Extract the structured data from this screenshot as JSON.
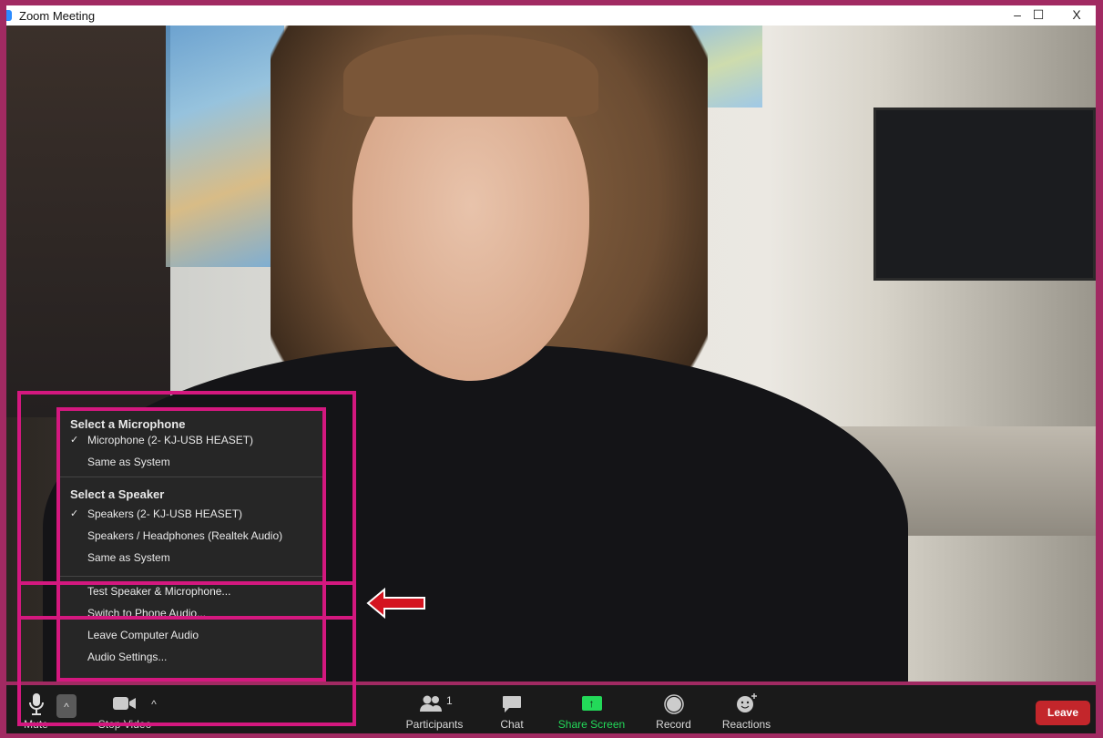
{
  "window": {
    "title": "Zoom Meeting",
    "minimize": "–",
    "maximize": "☐",
    "close": "X"
  },
  "audio_menu": {
    "mic_header": "Select a Microphone",
    "mics": [
      {
        "label": "Microphone (2- KJ-USB HEASET)",
        "checked": true
      },
      {
        "label": "Same as System",
        "checked": false
      }
    ],
    "speaker_header": "Select a Speaker",
    "speakers": [
      {
        "label": "Speakers (2- KJ-USB HEASET)",
        "checked": true
      },
      {
        "label": "Speakers / Headphones (Realtek Audio)",
        "checked": false
      },
      {
        "label": "Same as System",
        "checked": false
      }
    ],
    "test": "Test Speaker & Microphone...",
    "phone": "Switch to Phone Audio...",
    "leave_audio": "Leave Computer Audio",
    "settings": "Audio Settings...",
    "check": "✓"
  },
  "toolbar": {
    "mute": "Mute",
    "stop_video": "Stop Video",
    "participants": "Participants",
    "participants_count": "1",
    "chat": "Chat",
    "share_screen": "Share Screen",
    "record": "Record",
    "reactions": "Reactions",
    "leave": "Leave",
    "caret": "^"
  },
  "colors": {
    "highlight": "#d4187f",
    "share": "#23d959",
    "leave": "#c3262b",
    "frame": "#a12a62"
  }
}
